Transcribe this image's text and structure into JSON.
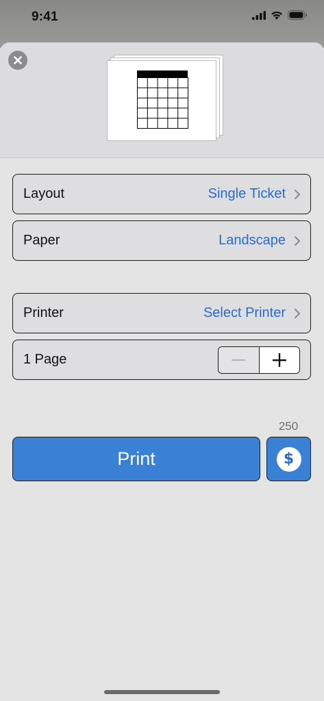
{
  "status_bar": {
    "time": "9:41",
    "icons": [
      "cellular-signal-icon",
      "wifi-icon",
      "battery-icon"
    ]
  },
  "header": {
    "close_icon": "close-icon",
    "preview": "ticket-preview"
  },
  "settings": {
    "layout": {
      "label": "Layout",
      "value": "Single Ticket"
    },
    "paper": {
      "label": "Paper",
      "value": "Landscape"
    },
    "printer": {
      "label": "Printer",
      "value": "Select Printer"
    },
    "pages": {
      "label": "1 Page",
      "count": 1
    }
  },
  "print": {
    "cost": "250",
    "button_label": "Print",
    "coin_symbol": "$"
  },
  "colors": {
    "accent": "#2a6bc7",
    "button": "#3a80d5"
  }
}
